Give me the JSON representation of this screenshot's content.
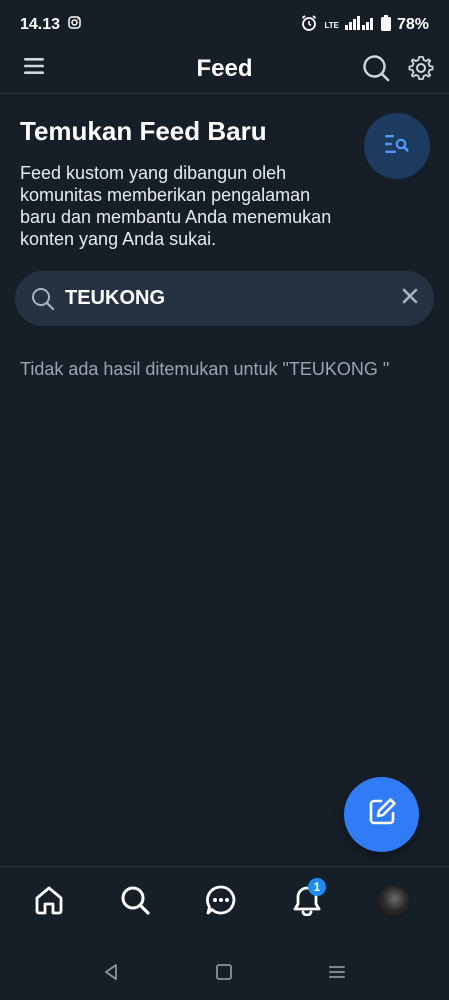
{
  "status_bar": {
    "time": "14.13",
    "network": "LTE",
    "battery": "78%"
  },
  "header": {
    "title": "Feed"
  },
  "discover": {
    "title": "Temukan Feed Baru",
    "description": "Feed kustom yang dibangun oleh komunitas memberikan pengalaman baru dan membantu Anda menemukan konten yang Anda sukai."
  },
  "search": {
    "value": "TEUKONG"
  },
  "results": {
    "message": "Tidak ada hasil ditemukan untuk \"TEUKONG \""
  },
  "bottom_nav": {
    "notifications_badge": "1"
  },
  "colors": {
    "background": "#161e27",
    "accent": "#2f7cf6",
    "search_bg": "#243241",
    "muted_text": "#9aa6b3"
  }
}
